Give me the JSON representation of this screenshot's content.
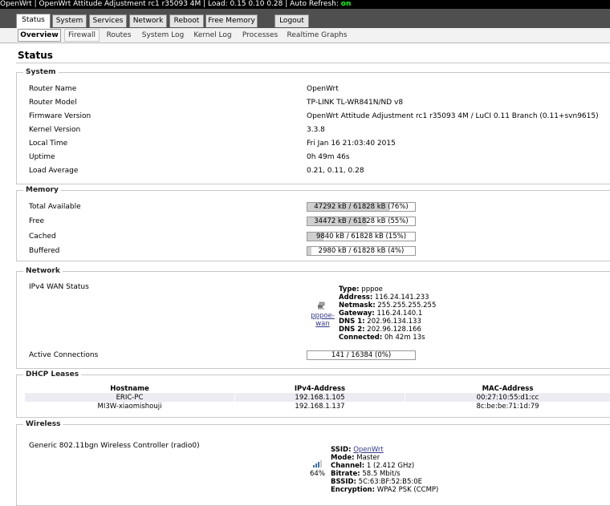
{
  "topbar": {
    "text": "OpenWrt | OpenWrt Attitude Adjustment rc1 r35093 4M | Load: 0.15 0.10 0.28 | Auto Refresh: ",
    "refresh_state": "on"
  },
  "main_tabs": [
    "Status",
    "System",
    "Services",
    "Network",
    "Reboot",
    "Free Memory",
    "Logout"
  ],
  "sub_tabs": [
    "Overview",
    "Firewall",
    "Routes",
    "System Log",
    "Kernel Log",
    "Processes",
    "Realtime Graphs"
  ],
  "page_title": "Status",
  "system": {
    "legend": "System",
    "rows": [
      {
        "label": "Router Name",
        "value": "OpenWrt"
      },
      {
        "label": "Router Model",
        "value": "TP-LINK TL-WR841N/ND v8"
      },
      {
        "label": "Firmware Version",
        "value": "OpenWrt Attitude Adjustment rc1 r35093 4M / LuCI 0.11 Branch (0.11+svn9615)"
      },
      {
        "label": "Kernel Version",
        "value": "3.3.8"
      },
      {
        "label": "Local Time",
        "value": "Fri Jan 16 21:03:40 2015"
      },
      {
        "label": "Uptime",
        "value": "0h 49m 46s"
      },
      {
        "label": "Load Average",
        "value": "0.21, 0.11, 0.28"
      }
    ]
  },
  "memory": {
    "legend": "Memory",
    "rows": [
      {
        "label": "Total Available",
        "text": "47292 kB / 61828 kB (76%)",
        "percent": 76
      },
      {
        "label": "Free",
        "text": "34472 kB / 61828 kB (55%)",
        "percent": 55
      },
      {
        "label": "Cached",
        "text": "9840 kB / 61828 kB (15%)",
        "percent": 15
      },
      {
        "label": "Buffered",
        "text": "2980 kB / 61828 kB (4%)",
        "percent": 4
      }
    ]
  },
  "network": {
    "legend": "Network",
    "wan_label": "IPv4 WAN Status",
    "iface_line1": "pppoe-",
    "iface_line2": "wan",
    "info": [
      {
        "key": "Type:",
        "value": "pppoe"
      },
      {
        "key": "Address:",
        "value": "116.24.141.233"
      },
      {
        "key": "Netmask:",
        "value": "255.255.255.255"
      },
      {
        "key": "Gateway:",
        "value": "116.24.140.1"
      },
      {
        "key": "DNS 1:",
        "value": "202.96.134.133"
      },
      {
        "key": "DNS 2:",
        "value": "202.96.128.166"
      },
      {
        "key": "Connected:",
        "value": "0h 42m 13s"
      }
    ],
    "conn_label": "Active Connections",
    "conn_text": "141 / 16384 (0%)",
    "conn_percent": 0
  },
  "dhcp": {
    "legend": "DHCP Leases",
    "headers": [
      "Hostname",
      "IPv4-Address",
      "MAC-Address"
    ],
    "rows": [
      [
        "ERIC-PC",
        "192.168.1.105",
        "00:27:10:55:d1:cc"
      ],
      [
        "MI3W-xiaomishouji",
        "192.168.1.137",
        "8c:be:be:71:1d:79"
      ]
    ]
  },
  "wireless": {
    "legend": "Wireless",
    "device": "Generic 802.11bgn Wireless Controller (radio0)",
    "signal": "64%",
    "info": [
      {
        "key": "SSID:",
        "value": "OpenWrt",
        "link": true
      },
      {
        "key": "Mode:",
        "value": "Master"
      },
      {
        "key": "Channel:",
        "value": "1 (2.412 GHz)"
      },
      {
        "key": "Bitrate:",
        "value": "58.5 Mbit/s"
      },
      {
        "key": "BSSID:",
        "value": "5C:63:BF:52:B5:0E"
      },
      {
        "key": "Encryption:",
        "value": "WPA2 PSK (CCMP)"
      }
    ]
  },
  "colors": {
    "accent_link": "#333a8c",
    "refresh_on": "#00ff00",
    "nav_bg": "#4f4f4f"
  }
}
